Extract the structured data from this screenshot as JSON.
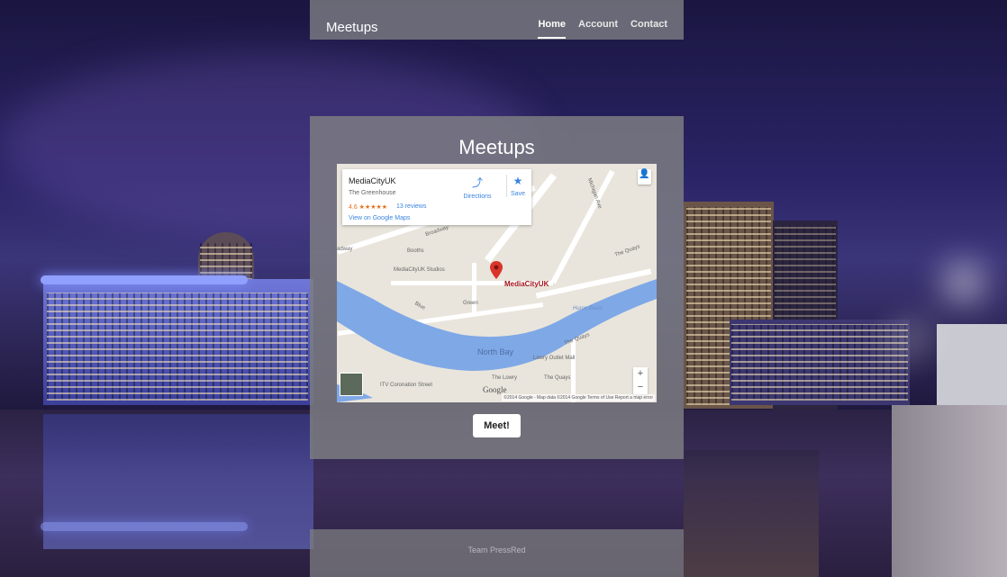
{
  "nav": {
    "brand": "Meetups",
    "links": [
      {
        "label": "Home",
        "active": true
      },
      {
        "label": "Account",
        "active": false
      },
      {
        "label": "Contact",
        "active": false
      }
    ]
  },
  "main": {
    "title": "Meetups",
    "button_label": "Meet!"
  },
  "map": {
    "place_name": "MediaCityUK",
    "place_sub": "The Greenhouse",
    "rating": "4.6 ★★★★★",
    "reviews": "13 reviews",
    "view_link": "View on Google Maps",
    "directions": "Directions",
    "save": "Save",
    "pin_label": "MediaCityUK",
    "labels": {
      "broadway": "Broadway",
      "broadway2": "adway",
      "booths": "Booths",
      "studios": "MediaCityUK Studios",
      "michigan": "Michigan Ave",
      "quays1": "The Quays",
      "huron": "Huron Basin",
      "quays2": "The Quays",
      "green": "Green",
      "blue": "Blue",
      "northbay": "North Bay",
      "lowry_outlet": "Lowry Outlet Mall",
      "lowry": "The Lowry",
      "quays3": "The Quays",
      "itv": "ITV Coronation Street"
    },
    "google": "Google",
    "footer": "©2014 Google - Map data ©2014 Google   Terms of Use   Report a map error"
  },
  "footer": {
    "text": "Team PressRed"
  },
  "colors": {
    "accent_link": "#3a84df",
    "pin": "#d9342b",
    "river": "#7fa8e6"
  }
}
